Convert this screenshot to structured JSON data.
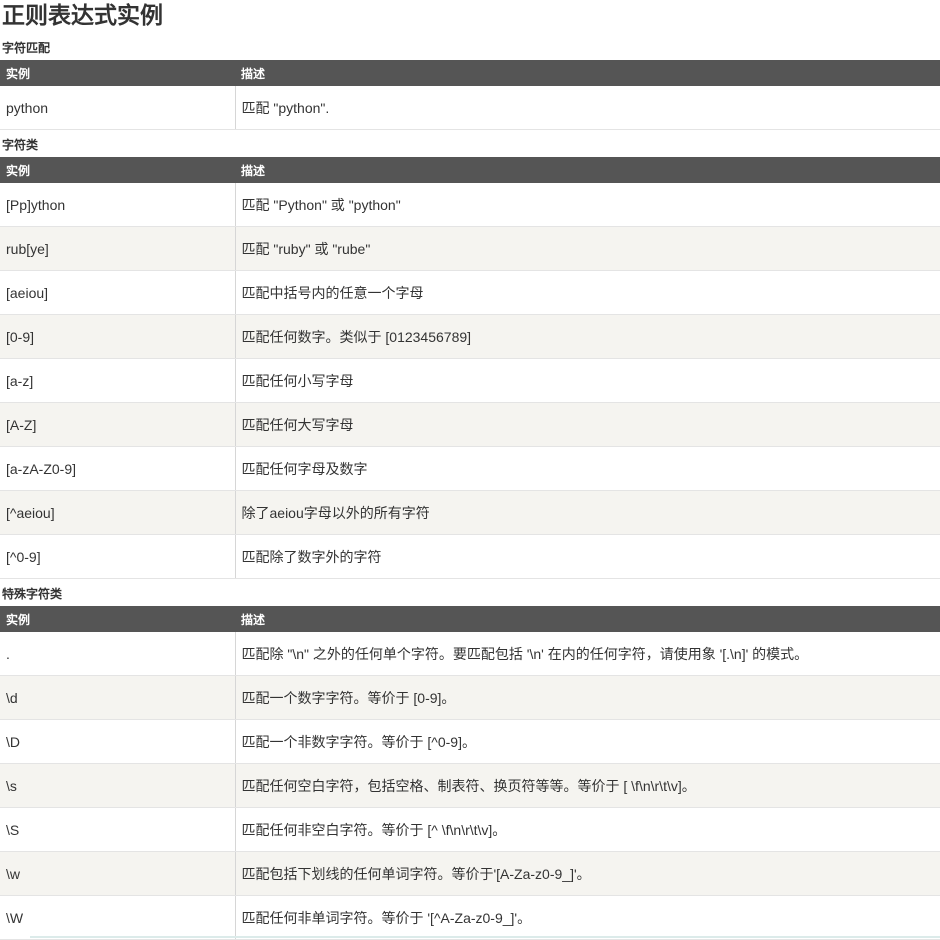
{
  "page_title": "正则表达式实例",
  "sections": [
    {
      "title": "字符匹配",
      "headers": [
        "实例",
        "描述"
      ],
      "rows": [
        [
          "python",
          "匹配 \"python\"."
        ]
      ]
    },
    {
      "title": "字符类",
      "headers": [
        "实例",
        "描述"
      ],
      "rows": [
        [
          "[Pp]ython",
          "匹配 \"Python\" 或 \"python\""
        ],
        [
          "rub[ye]",
          "匹配 \"ruby\" 或 \"rube\""
        ],
        [
          "[aeiou]",
          "匹配中括号内的任意一个字母"
        ],
        [
          "[0-9]",
          "匹配任何数字。类似于 [0123456789]"
        ],
        [
          "[a-z]",
          "匹配任何小写字母"
        ],
        [
          "[A-Z]",
          "匹配任何大写字母"
        ],
        [
          "[a-zA-Z0-9]",
          "匹配任何字母及数字"
        ],
        [
          "[^aeiou]",
          "除了aeiou字母以外的所有字符"
        ],
        [
          "[^0-9]",
          "匹配除了数字外的字符"
        ]
      ]
    },
    {
      "title": "特殊字符类",
      "headers": [
        "实例",
        "描述"
      ],
      "rows": [
        [
          ".",
          "匹配除 \"\\n\" 之外的任何单个字符。要匹配包括 '\\n' 在内的任何字符，请使用象 '[.\\n]' 的模式。"
        ],
        [
          "\\d",
          "匹配一个数字字符。等价于 [0-9]。"
        ],
        [
          "\\D",
          "匹配一个非数字字符。等价于 [^0-9]。"
        ],
        [
          "\\s",
          "匹配任何空白字符，包括空格、制表符、换页符等等。等价于 [ \\f\\n\\r\\t\\v]。"
        ],
        [
          "\\S",
          "匹配任何非空白字符。等价于 [^ \\f\\n\\r\\t\\v]。"
        ],
        [
          "\\w",
          "匹配包括下划线的任何单词字符。等价于'[A-Za-z0-9_]'。"
        ],
        [
          "\\W",
          "匹配任何非单词字符。等价于 '[^A-Za-z0-9_]'。"
        ]
      ]
    }
  ]
}
